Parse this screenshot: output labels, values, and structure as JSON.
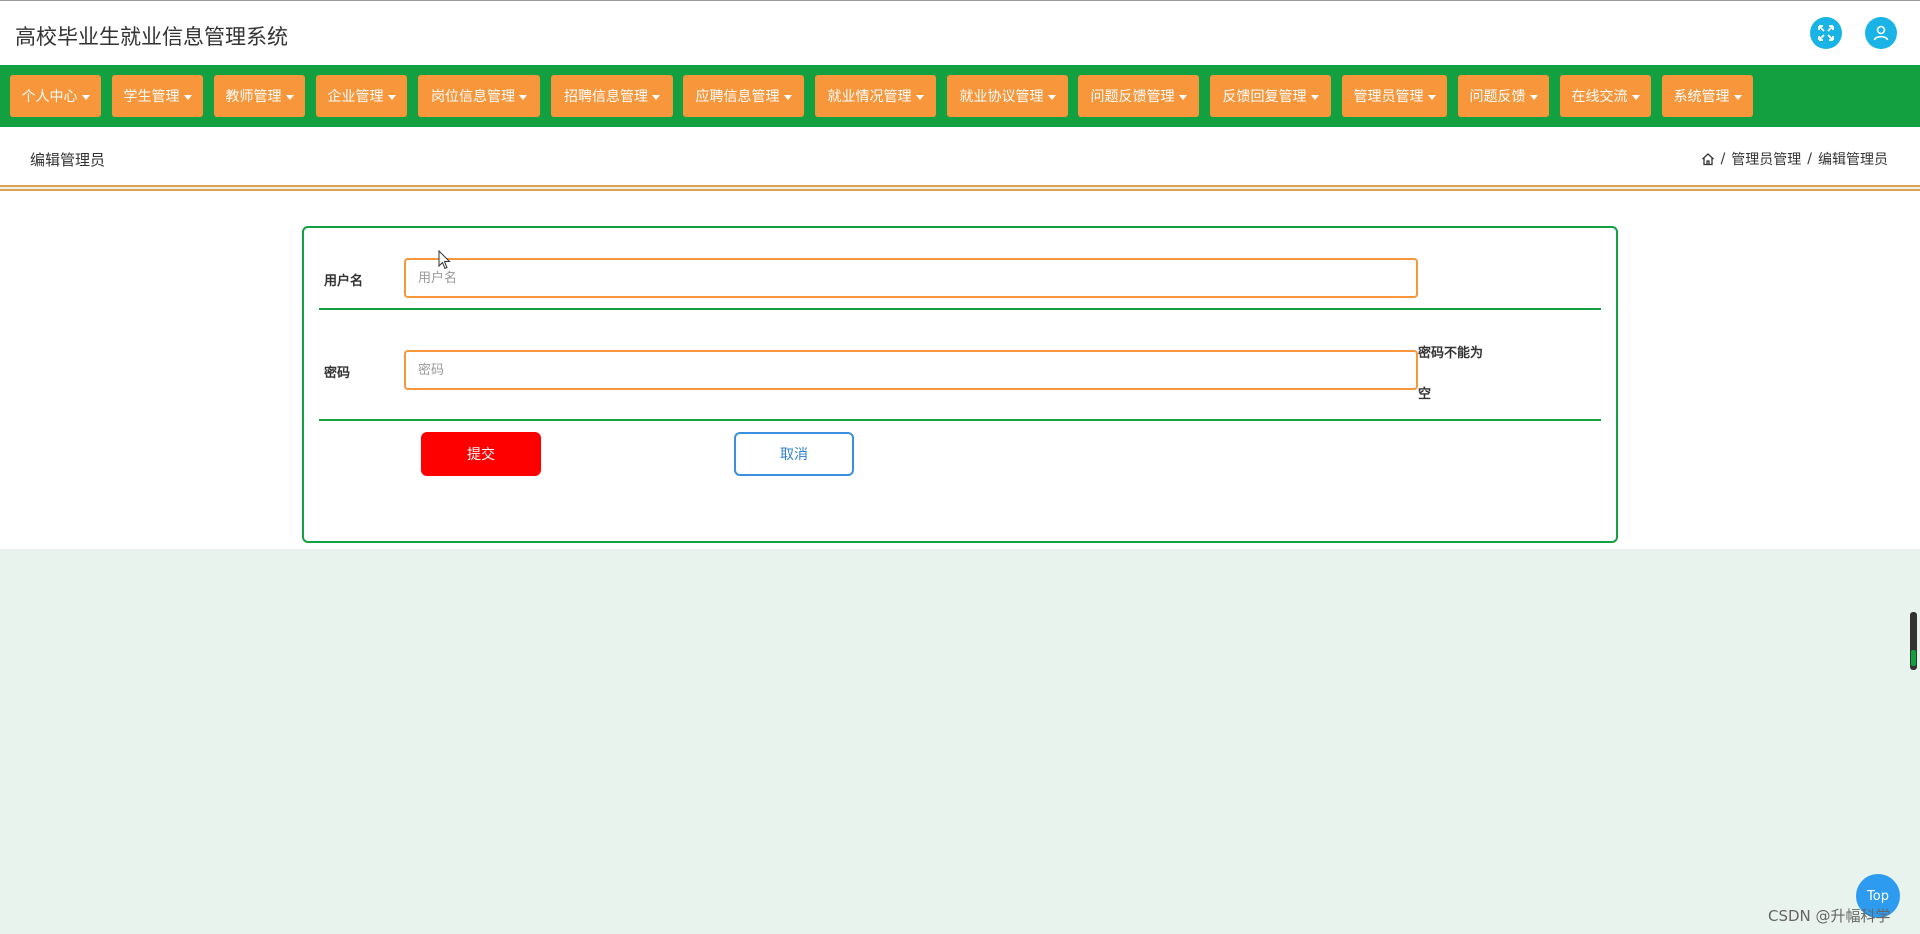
{
  "header": {
    "title": "高校毕业生就业信息管理系统",
    "fullscreen_icon": "fullscreen-icon",
    "user_icon": "user-icon",
    "accent_color": "#1ab3e6"
  },
  "nav": {
    "bg_color": "#13a040",
    "item_color": "#f7963b",
    "items": [
      {
        "label": "个人中心"
      },
      {
        "label": "学生管理"
      },
      {
        "label": "教师管理"
      },
      {
        "label": "企业管理"
      },
      {
        "label": "岗位信息管理"
      },
      {
        "label": "招聘信息管理"
      },
      {
        "label": "应聘信息管理"
      },
      {
        "label": "就业情况管理"
      },
      {
        "label": "就业协议管理"
      },
      {
        "label": "问题反馈管理"
      },
      {
        "label": "反馈回复管理"
      },
      {
        "label": "管理员管理"
      },
      {
        "label": "问题反馈"
      },
      {
        "label": "在线交流"
      },
      {
        "label": "系统管理"
      }
    ]
  },
  "page": {
    "title": "编辑管理员",
    "breadcrumb": {
      "home_icon": "home-icon",
      "sep1": "/",
      "level1": "管理员管理",
      "sep2": "/",
      "level2": "编辑管理员"
    }
  },
  "form": {
    "username": {
      "label": "用户名",
      "placeholder": "用户名",
      "value": ""
    },
    "password": {
      "label": "密码",
      "placeholder": "密码",
      "value": "",
      "error_line1": "密码不能为",
      "error_line2": "空"
    },
    "submit_label": "提交",
    "cancel_label": "取消"
  },
  "top_button": {
    "label": "Top"
  },
  "watermark": "CSDN @升幅科学"
}
